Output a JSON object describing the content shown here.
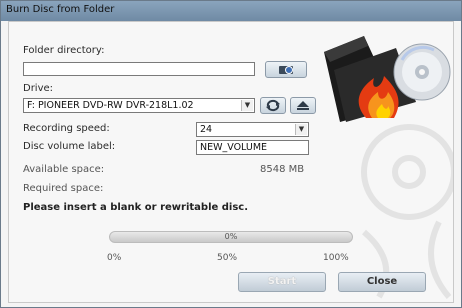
{
  "window": {
    "title": "Burn Disc from Folder"
  },
  "folder": {
    "label": "Folder directory:",
    "value": "",
    "browse_icon": "folder-browse-icon"
  },
  "drive": {
    "label": "Drive:",
    "value": "F: PIONEER DVD-RW  DVR-218L1.02",
    "refresh_icon": "refresh-icon",
    "eject_icon": "eject-icon"
  },
  "recording_speed": {
    "label": "Recording speed:",
    "value": "24"
  },
  "volume_label": {
    "label": "Disc volume label:",
    "value": "NEW_VOLUME"
  },
  "available_space": {
    "label": "Available space:",
    "value": "8548 MB"
  },
  "required_space": {
    "label": "Required space:",
    "value": ""
  },
  "message": "Please insert a blank or rewritable disc.",
  "progress": {
    "value": 0,
    "text": "0%",
    "ticks": [
      "0%",
      "50%",
      "100%"
    ]
  },
  "buttons": {
    "start": "Start",
    "close": "Close"
  },
  "illustration": "burn-disc-illustration"
}
